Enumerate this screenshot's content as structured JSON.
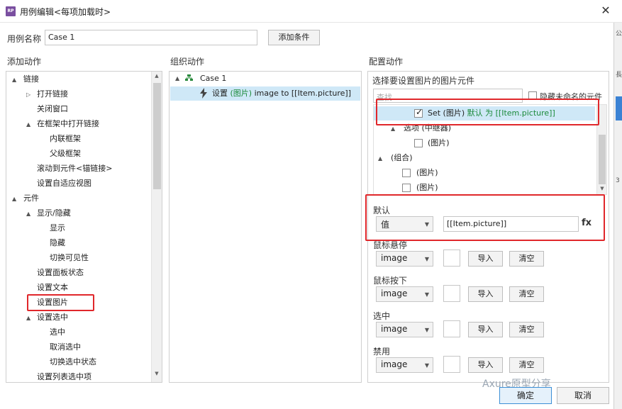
{
  "window": {
    "app_icon_text": "RP",
    "title": "用例编辑<每项加载时>",
    "close_label": "✕"
  },
  "case_name": {
    "label": "用例名称",
    "value": "Case 1",
    "add_condition": "添加条件"
  },
  "add_actions": {
    "heading": "添加动作",
    "items": [
      {
        "label": "链接",
        "level": 0,
        "expander": "▲"
      },
      {
        "label": "打开链接",
        "level": 1,
        "expander": "▷"
      },
      {
        "label": "关闭窗口",
        "level": 1,
        "expander": ""
      },
      {
        "label": "在框架中打开链接",
        "level": 1,
        "expander": "▲"
      },
      {
        "label": "内联框架",
        "level": 2,
        "expander": ""
      },
      {
        "label": "父级框架",
        "level": 2,
        "expander": ""
      },
      {
        "label": "滚动到元件<锚链接>",
        "level": 1,
        "expander": ""
      },
      {
        "label": "设置自适应视图",
        "level": 1,
        "expander": ""
      },
      {
        "label": "元件",
        "level": 0,
        "expander": "▲"
      },
      {
        "label": "显示/隐藏",
        "level": 1,
        "expander": "▲"
      },
      {
        "label": "显示",
        "level": 2,
        "expander": ""
      },
      {
        "label": "隐藏",
        "level": 2,
        "expander": ""
      },
      {
        "label": "切换可见性",
        "level": 2,
        "expander": ""
      },
      {
        "label": "设置面板状态",
        "level": 1,
        "expander": ""
      },
      {
        "label": "设置文本",
        "level": 1,
        "expander": ""
      },
      {
        "label": "设置图片",
        "level": 1,
        "expander": ""
      },
      {
        "label": "设置选中",
        "level": 1,
        "expander": "▲"
      },
      {
        "label": "选中",
        "level": 2,
        "expander": ""
      },
      {
        "label": "取消选中",
        "level": 2,
        "expander": ""
      },
      {
        "label": "切换选中状态",
        "level": 2,
        "expander": ""
      },
      {
        "label": "设置列表选中项",
        "level": 1,
        "expander": ""
      }
    ],
    "scroll_up": "▲",
    "scroll_down": "▼"
  },
  "organize_actions": {
    "heading": "组织动作",
    "case_expander": "▲",
    "case_label": "Case 1",
    "action_prefix": "设置 ",
    "action_target": "(图片)",
    "action_suffix": " image to [[Item.picture]]"
  },
  "configure_actions": {
    "heading": "配置动作",
    "subheading": "选择要设置图片的图片元件",
    "search_placeholder": "查找",
    "hide_unnamed_label": "隐藏未命名的元件",
    "widgets": [
      {
        "label_prefix": "Set (图片)",
        "label_green": " 默认 为 [[Item.picture]]",
        "checked": true,
        "expander": ""
      },
      {
        "label_prefix": "选项 (中继器)",
        "label_green": "",
        "checked": false,
        "expander": "▲",
        "no_checkbox": true
      },
      {
        "label_prefix": "(图片)",
        "label_green": "",
        "checked": false,
        "expander": ""
      },
      {
        "label_prefix": "(组合)",
        "label_green": "",
        "checked": false,
        "expander": "▲",
        "no_checkbox": true
      },
      {
        "label_prefix": "(图片)",
        "label_green": "",
        "checked": false,
        "expander": ""
      },
      {
        "label_prefix": "(图片)",
        "label_green": "",
        "checked": false,
        "expander": ""
      }
    ],
    "default_section": {
      "label": "默认",
      "type_value": "值",
      "value": "[[Item.picture]]",
      "fx": "fx"
    },
    "states": [
      {
        "label": "鼠标悬停",
        "type_value": "image",
        "import": "导入",
        "clear": "清空"
      },
      {
        "label": "鼠标按下",
        "type_value": "image",
        "import": "导入",
        "clear": "清空"
      },
      {
        "label": "选中",
        "type_value": "image",
        "import": "导入",
        "clear": "清空"
      },
      {
        "label": "禁用",
        "type_value": "image",
        "import": "导入",
        "clear": "清空"
      }
    ]
  },
  "footer": {
    "ok": "确定",
    "cancel": "取消",
    "watermark": "Axure原型分享"
  },
  "background_window": {
    "chip1": "公",
    "chip2": "長",
    "chip3": "",
    "chip4": "3"
  },
  "colors": {
    "highlight_red": "#e0272b",
    "selection_blue": "#cfe8f7",
    "green_text": "#1b8a3a"
  }
}
